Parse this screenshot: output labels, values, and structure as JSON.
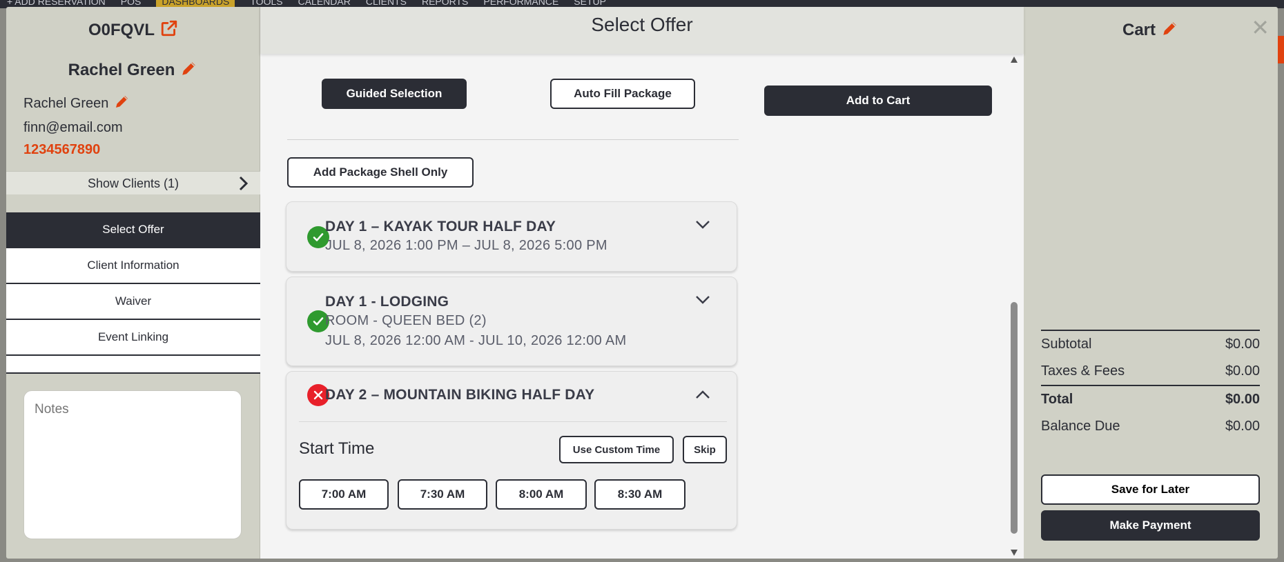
{
  "background": {
    "nav": [
      "+ ADD RESERVATION",
      "POS",
      "DASHBOARDS",
      "TOOLS",
      "CALENDAR",
      "CLIENTS",
      "REPORTS",
      "PERFORMANCE",
      "SETUP"
    ]
  },
  "left": {
    "reservation_code": "O0FQVL",
    "client_name_header": "Rachel Green",
    "client_name": "Rachel Green",
    "email": "finn@email.com",
    "phone": "1234567890",
    "show_clients": "Show Clients (1)",
    "nav": {
      "select_offer": "Select Offer",
      "client_information": "Client Information",
      "waiver": "Waiver",
      "event_linking": "Event Linking"
    },
    "notes_placeholder": "Notes"
  },
  "center": {
    "title": "Select Offer",
    "guided_selection": "Guided Selection",
    "auto_fill_package": "Auto Fill Package",
    "add_to_cart": "Add to Cart",
    "add_package_shell_only": "Add Package Shell Only",
    "items": [
      {
        "title": "DAY 1 – KAYAK TOUR HALF DAY",
        "lines": [
          "JUL 8, 2026 1:00 PM – JUL 8, 2026 5:00 PM"
        ],
        "status": "complete"
      },
      {
        "title": "DAY 1 - LODGING",
        "lines": [
          "ROOM - QUEEN BED (2)",
          "JUL 8, 2026 12:00 AM - JUL 10, 2026 12:00 AM"
        ],
        "status": "complete"
      },
      {
        "title": "DAY 2 – MOUNTAIN BIKING HALF DAY",
        "status": "incomplete",
        "start_time_label": "Start Time",
        "use_custom_time": "Use Custom Time",
        "skip": "Skip",
        "times": [
          "7:00 AM",
          "7:30 AM",
          "8:00 AM",
          "8:30 AM"
        ]
      }
    ]
  },
  "cart": {
    "title": "Cart",
    "subtotal_label": "Subtotal",
    "subtotal": "$0.00",
    "taxes_label": "Taxes & Fees",
    "taxes": "$0.00",
    "total_label": "Total",
    "total": "$0.00",
    "balance_label": "Balance Due",
    "balance": "$0.00",
    "save_for_later": "Save for Later",
    "make_payment": "Make Payment"
  },
  "colors": {
    "accent": "#e0420f",
    "dark": "#2b2d35",
    "panel": "#d0d1c6",
    "success": "#2f9a2f",
    "error": "#e8202a"
  }
}
